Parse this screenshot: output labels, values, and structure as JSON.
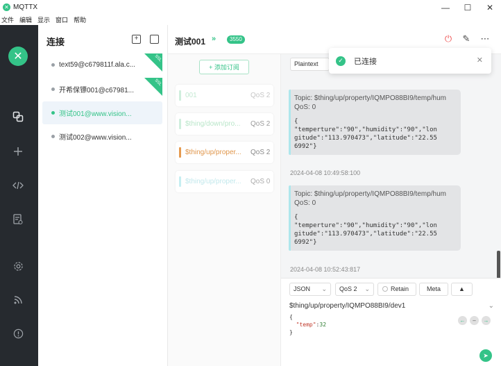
{
  "window": {
    "title": "MQTTX",
    "minimize": "—",
    "maximize": "☐",
    "close": "✕"
  },
  "menu": [
    "文件",
    "编辑",
    "显示",
    "窗口",
    "帮助"
  ],
  "connections": {
    "heading": "连接",
    "items": [
      {
        "label": "text59@c679811f.ala.c...",
        "ssl": "SSL"
      },
      {
        "label": "开希保镖001@c67981...",
        "ssl": "SSL"
      },
      {
        "label": "测试001@www.vision..."
      },
      {
        "label": "测试002@www.vision..."
      }
    ]
  },
  "header": {
    "title": "测试001",
    "count": "3550"
  },
  "subscriptions": {
    "add_label": "+ 添加订阅",
    "items": [
      {
        "topic": "001",
        "qos": "QoS 2",
        "color": "#8fd6a8"
      },
      {
        "topic": "$thing/down/pro...",
        "qos": "QoS 2",
        "color": "#9fe2b5"
      },
      {
        "topic": "$thing/up/proper...",
        "qos": "QoS 2",
        "color": "#e59a4f"
      },
      {
        "topic": "$thing/up/proper...",
        "qos": "QoS 0",
        "color": "#aee7ec"
      }
    ]
  },
  "messages": {
    "format": "Plaintext",
    "items": [
      {
        "topic": "Topic: $thing/up/property/IQMPO88BI9/temp/hum",
        "qos": "QoS: 0",
        "payload": "{\n\"temperture\":\"90\",\"humidity\":\"90\",\"lon\ngitude\":\"113.970473\",\"latitude\":\"22.55\n6992\"}",
        "time": "2024-04-08 10:49:58:100"
      },
      {
        "topic": "Topic: $thing/up/property/IQMPO88BI9/temp/hum",
        "qos": "QoS: 0",
        "payload": "{\n\"temperture\":\"90\",\"humidity\":\"90\",\"lon\ngitude\":\"113.970473\",\"latitude\":\"22.55\n6992\"}",
        "time": "2024-04-08 10:52:43:817"
      }
    ]
  },
  "toast": {
    "text": "已连接"
  },
  "publish": {
    "format": "JSON",
    "qos": "QoS 2",
    "retain": "Retain",
    "meta": "Meta",
    "topic": "$thing/up/property/IQMPO88BI9/dev1",
    "payload_key": "\"temp\"",
    "payload_value": "32"
  }
}
